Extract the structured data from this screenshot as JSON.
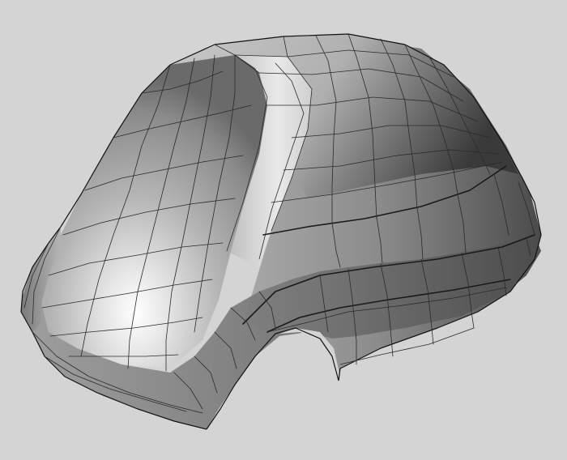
{
  "viewport": {
    "background_color": "#d4d4d4",
    "model": "car-body-mesh",
    "shading": "gray-smooth-wireframe",
    "colors": {
      "highlight": "#ffffff",
      "mid": "#9e9e9e",
      "shadow": "#3c3c3c",
      "wire": "#2a2a2a"
    }
  }
}
